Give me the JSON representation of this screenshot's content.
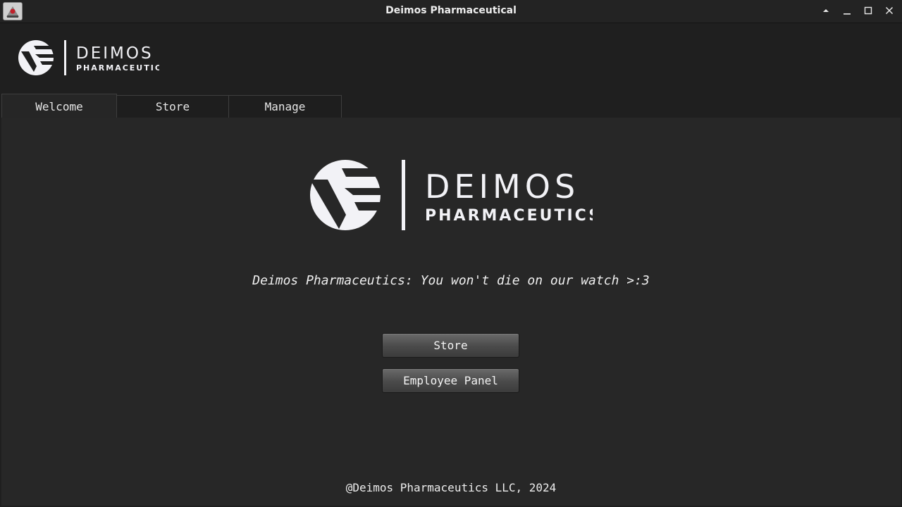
{
  "window": {
    "title": "Deimos Pharmaceutical"
  },
  "logo": {
    "name": "DEIMOS",
    "sub": "PHARMACEUTICS"
  },
  "tabs": [
    {
      "label": "Welcome",
      "active": true
    },
    {
      "label": "Store",
      "active": false
    },
    {
      "label": "Manage",
      "active": false
    }
  ],
  "welcome": {
    "tagline": "Deimos Pharmaceutics: You won't die on our watch >:3",
    "store_button": "Store",
    "employee_button": "Employee Panel",
    "footer": "@Deimos Pharmaceutics LLC, 2024"
  },
  "colors": {
    "background": "#1f1f1f",
    "panel": "#272727",
    "logo": "#f2f2f6"
  }
}
